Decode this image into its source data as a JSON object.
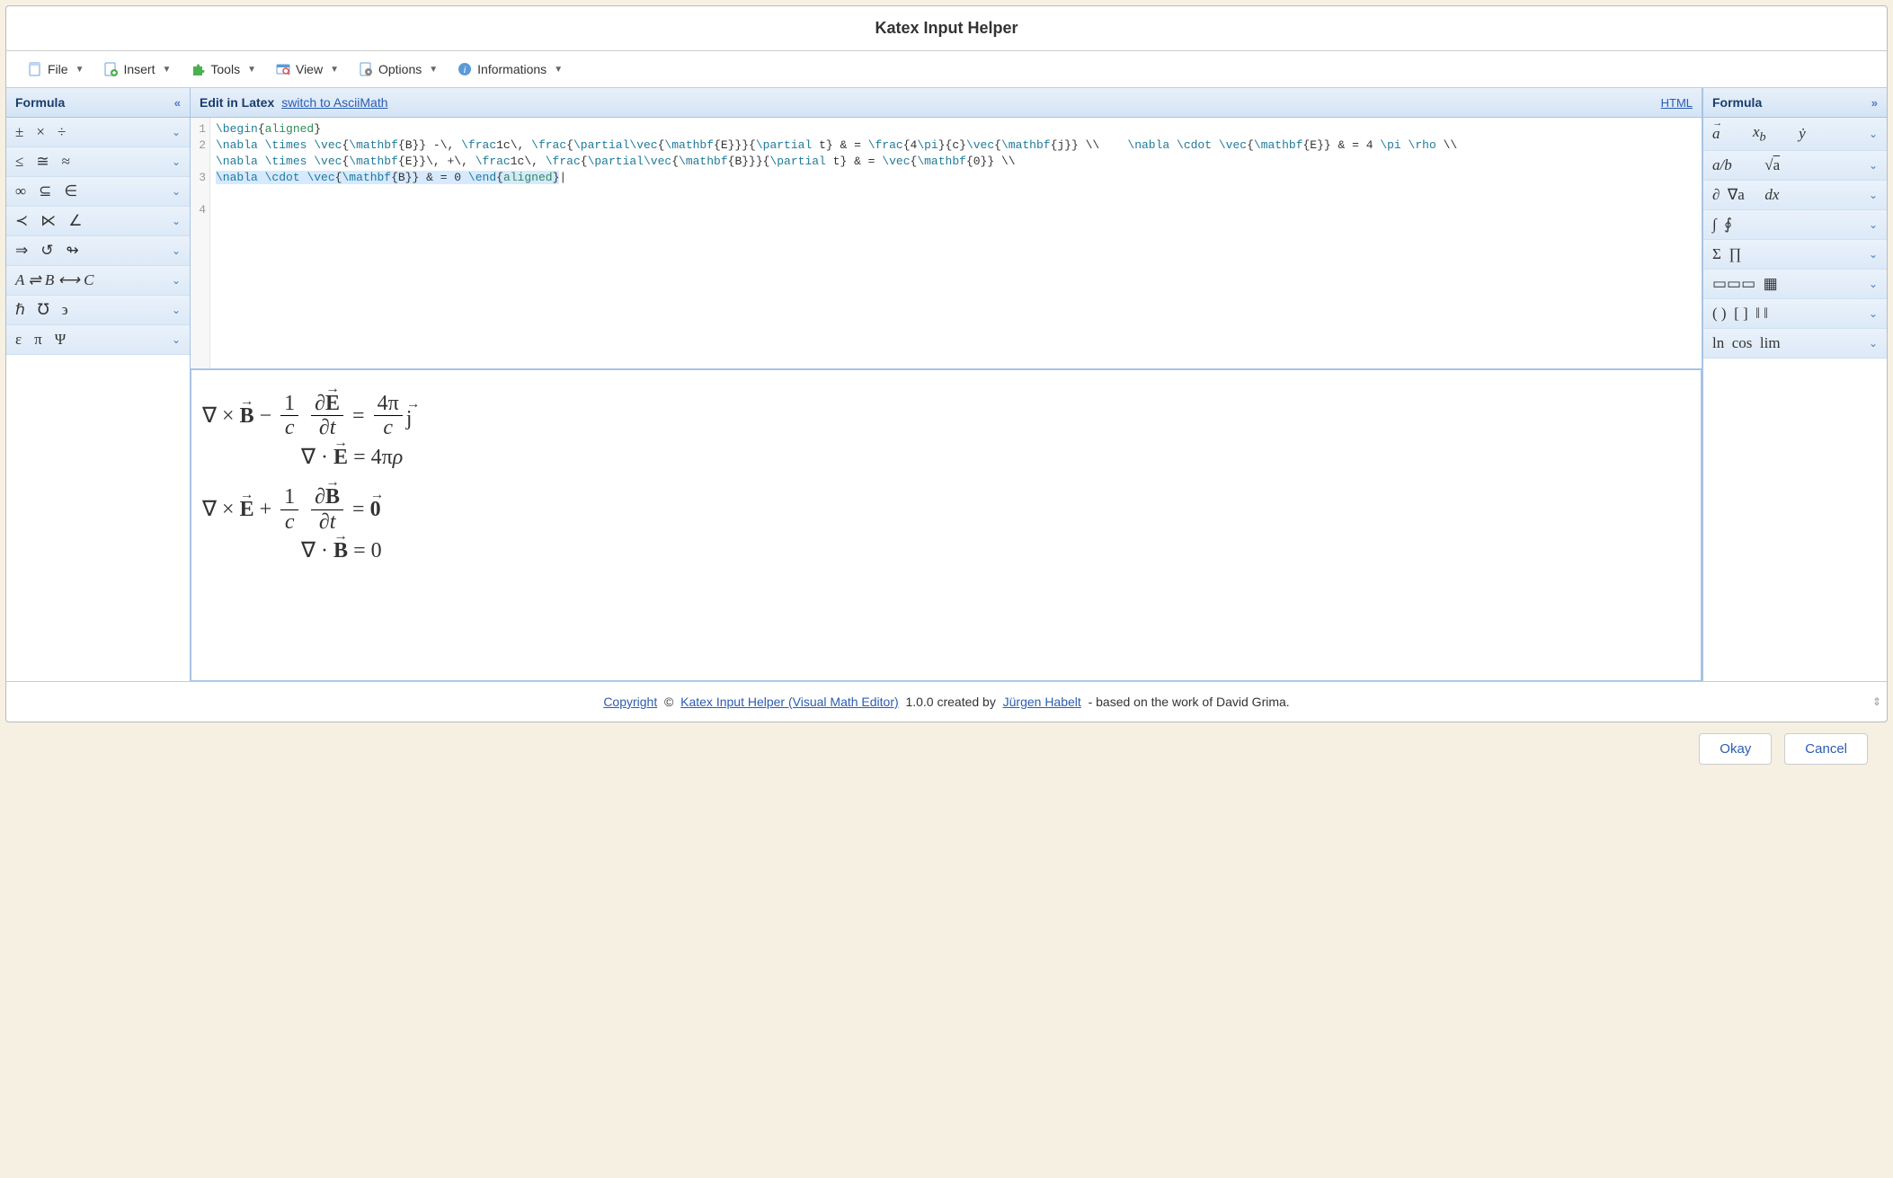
{
  "window": {
    "title": "Katex Input Helper"
  },
  "menu": {
    "file": "File",
    "insert": "Insert",
    "tools": "Tools",
    "view": "View",
    "options": "Options",
    "informations": "Informations"
  },
  "left_panel": {
    "title": "Formula",
    "rows": [
      {
        "symbols": [
          "±",
          "×",
          "÷"
        ]
      },
      {
        "symbols": [
          "≤",
          "≅",
          "≈"
        ]
      },
      {
        "symbols": [
          "∞",
          "⊆",
          "∈"
        ]
      },
      {
        "symbols": [
          "≺",
          "⋉",
          "∠"
        ]
      },
      {
        "symbols": [
          "⇒",
          "↺",
          "↬"
        ]
      },
      {
        "symbols": [
          "A ⇌ B ⟷ C"
        ]
      },
      {
        "symbols": [
          "ℏ",
          "℧",
          "϶"
        ]
      },
      {
        "symbols": [
          "ε",
          "π",
          "Ψ"
        ]
      }
    ]
  },
  "center_panel": {
    "title": "Edit in Latex",
    "switch_link": "switch to AsciiMath",
    "html_link": "HTML",
    "code_lines": [
      {
        "n": "1",
        "text": "\\begin{aligned}"
      },
      {
        "n": "2",
        "text": "\\nabla \\times \\vec{\\mathbf{B}} -\\, \\frac1c\\, \\frac{\\partial\\vec{\\mathbf{E}}}{\\partial t} & = \\frac{4\\pi}{c}\\vec{\\mathbf{j}} \\\\    \\nabla \\cdot \\vec{\\mathbf{E}} & = 4 \\pi \\rho \\\\"
      },
      {
        "n": "3",
        "text": "\\nabla \\times \\vec{\\mathbf{E}}\\, +\\, \\frac1c\\, \\frac{\\partial\\vec{\\mathbf{B}}}{\\partial t} & = \\vec{\\mathbf{0}} \\\\"
      },
      {
        "n": "4",
        "text": "\\nabla \\cdot \\vec{\\mathbf{B}} & = 0 \\end{aligned}"
      }
    ]
  },
  "right_panel": {
    "title": "Formula",
    "rows": [
      {
        "html": "<span class='vec' style='font-style:italic;font-weight:normal'>a</span>&nbsp;&nbsp;<span class='sym-italic'>x<sub>b</sub></span>&nbsp;&nbsp;<span class='sym-italic'>ẏ</span>"
      },
      {
        "html": "<span class='sym-italic'>a/b</span>&nbsp;&nbsp;<span>√<span style='text-decoration:overline'>a</span></span>"
      },
      {
        "html": "∂&nbsp;&nbsp;∇a&nbsp;&nbsp;<span class='sym-italic'>dx</span>"
      },
      {
        "html": "∫&nbsp;&nbsp;∮"
      },
      {
        "html": "Σ&nbsp;&nbsp;∏"
      },
      {
        "html": "▭▭▭&nbsp;&nbsp;▦"
      },
      {
        "html": "( )&nbsp;&nbsp;[ ]&nbsp;&nbsp;‖ ‖"
      },
      {
        "html": "ln&nbsp;&nbsp;cos&nbsp;&nbsp;lim"
      }
    ]
  },
  "footer": {
    "copyright": "Copyright",
    "symbol": "©",
    "app_link": "Katex Input Helper (Visual Math Editor)",
    "version_text": "1.0.0 created by",
    "author_link": "Jürgen Habelt",
    "tail": "- based on the work of David Grima."
  },
  "buttons": {
    "ok": "Okay",
    "cancel": "Cancel"
  }
}
